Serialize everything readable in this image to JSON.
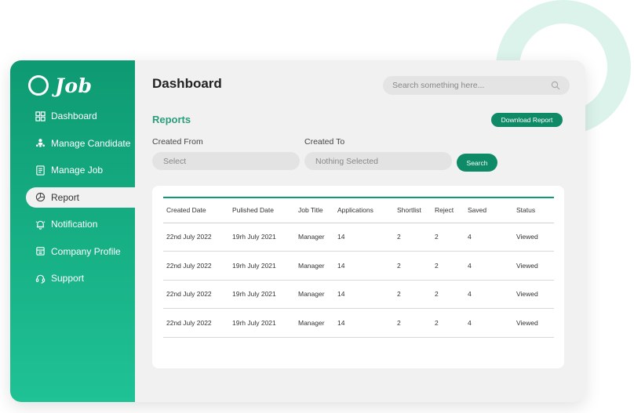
{
  "brand": {
    "name": "Job"
  },
  "sidebar": {
    "items": [
      {
        "label": "Dashboard",
        "icon": "grid-icon",
        "active": false
      },
      {
        "label": "Manage Candidate",
        "icon": "users-icon",
        "active": false
      },
      {
        "label": "Manage Job",
        "icon": "document-icon",
        "active": false
      },
      {
        "label": "Report",
        "icon": "chart-pie-icon",
        "active": true
      },
      {
        "label": "Notification",
        "icon": "bell-icon",
        "active": false
      },
      {
        "label": "Company Profile",
        "icon": "building-icon",
        "active": false
      },
      {
        "label": "Support",
        "icon": "headset-icon",
        "active": false
      }
    ]
  },
  "header": {
    "title": "Dashboard",
    "search_placeholder": "Search something here..."
  },
  "reports": {
    "title": "Reports",
    "download_label": "Download Report",
    "created_from_label": "Created From",
    "created_to_label": "Created To",
    "from_value": "Select",
    "to_value": "Nothing Selected",
    "search_label": "Search"
  },
  "table": {
    "headers": [
      "Created Date",
      "Pulished Date",
      "Job Title",
      "Applications",
      "Shortlist",
      "Reject",
      "Saved",
      "Status"
    ],
    "rows": [
      [
        "22nd July 2022",
        "19rh July 2021",
        "Manager",
        "14",
        "2",
        "2",
        "4",
        "Viewed"
      ],
      [
        "22nd July 2022",
        "19rh July 2021",
        "Manager",
        "14",
        "2",
        "2",
        "4",
        "Viewed"
      ],
      [
        "22nd July 2022",
        "19rh July 2021",
        "Manager",
        "14",
        "2",
        "2",
        "4",
        "Viewed"
      ],
      [
        "22nd July 2022",
        "19rh July 2021",
        "Manager",
        "14",
        "2",
        "2",
        "4",
        "Viewed"
      ]
    ]
  },
  "colors": {
    "accent": "#0e9a72",
    "accent_light": "#1fc295",
    "button": "#0e8a66",
    "section_title": "#2a9d7c"
  }
}
